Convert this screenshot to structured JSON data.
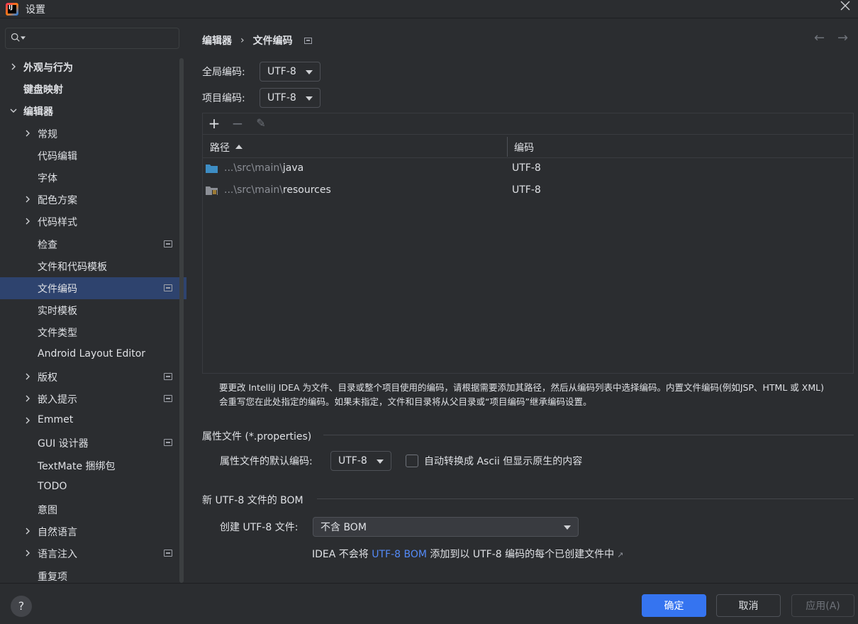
{
  "window": {
    "title": "设置",
    "logo_text": "IJ"
  },
  "search": {
    "placeholder": ""
  },
  "sidebar": {
    "items": [
      {
        "label": "外观与行为",
        "level": 0,
        "chevron": "right",
        "bold": true,
        "project_icon": false,
        "selected": false
      },
      {
        "label": "键盘映射",
        "level": 0,
        "chevron": "",
        "bold": true,
        "project_icon": false,
        "selected": false
      },
      {
        "label": "编辑器",
        "level": 0,
        "chevron": "down",
        "bold": true,
        "project_icon": false,
        "selected": false
      },
      {
        "label": "常规",
        "level": 1,
        "chevron": "right",
        "bold": false,
        "project_icon": false,
        "selected": false
      },
      {
        "label": "代码编辑",
        "level": 1,
        "chevron": "",
        "bold": false,
        "project_icon": false,
        "selected": false
      },
      {
        "label": "字体",
        "level": 1,
        "chevron": "",
        "bold": false,
        "project_icon": false,
        "selected": false
      },
      {
        "label": "配色方案",
        "level": 1,
        "chevron": "right",
        "bold": false,
        "project_icon": false,
        "selected": false
      },
      {
        "label": "代码样式",
        "level": 1,
        "chevron": "right",
        "bold": false,
        "project_icon": false,
        "selected": false
      },
      {
        "label": "检查",
        "level": 1,
        "chevron": "",
        "bold": false,
        "project_icon": true,
        "selected": false
      },
      {
        "label": "文件和代码模板",
        "level": 1,
        "chevron": "",
        "bold": false,
        "project_icon": false,
        "selected": false
      },
      {
        "label": "文件编码",
        "level": 1,
        "chevron": "",
        "bold": false,
        "project_icon": true,
        "selected": true
      },
      {
        "label": "实时模板",
        "level": 1,
        "chevron": "",
        "bold": false,
        "project_icon": false,
        "selected": false
      },
      {
        "label": "文件类型",
        "level": 1,
        "chevron": "",
        "bold": false,
        "project_icon": false,
        "selected": false
      },
      {
        "label": "Android Layout Editor",
        "level": 1,
        "chevron": "",
        "bold": false,
        "project_icon": false,
        "selected": false
      },
      {
        "label": "版权",
        "level": 1,
        "chevron": "right",
        "bold": false,
        "project_icon": true,
        "selected": false
      },
      {
        "label": "嵌入提示",
        "level": 1,
        "chevron": "right",
        "bold": false,
        "project_icon": true,
        "selected": false
      },
      {
        "label": "Emmet",
        "level": 1,
        "chevron": "right",
        "bold": false,
        "project_icon": false,
        "selected": false
      },
      {
        "label": "GUI 设计器",
        "level": 1,
        "chevron": "",
        "bold": false,
        "project_icon": true,
        "selected": false
      },
      {
        "label": "TextMate 捆绑包",
        "level": 1,
        "chevron": "",
        "bold": false,
        "project_icon": false,
        "selected": false
      },
      {
        "label": "TODO",
        "level": 1,
        "chevron": "",
        "bold": false,
        "project_icon": false,
        "selected": false
      },
      {
        "label": "意图",
        "level": 1,
        "chevron": "",
        "bold": false,
        "project_icon": false,
        "selected": false
      },
      {
        "label": "自然语言",
        "level": 1,
        "chevron": "right",
        "bold": false,
        "project_icon": false,
        "selected": false
      },
      {
        "label": "语言注入",
        "level": 1,
        "chevron": "right",
        "bold": false,
        "project_icon": true,
        "selected": false
      },
      {
        "label": "重复项",
        "level": 1,
        "chevron": "",
        "bold": false,
        "project_icon": false,
        "selected": false
      }
    ]
  },
  "breadcrumb": {
    "parent": "编辑器",
    "separator": "›",
    "current": "文件编码"
  },
  "nav": {
    "back": "←",
    "forward": "→"
  },
  "global_encoding": {
    "label": "全局编码:",
    "value": "UTF-8"
  },
  "project_encoding": {
    "label": "项目编码:",
    "value": "UTF-8"
  },
  "table": {
    "toolbar": {
      "add": "+",
      "remove": "−",
      "edit": "✎"
    },
    "columns": [
      "路径",
      "编码"
    ],
    "rows": [
      {
        "prefix": "...\\src\\main\\",
        "name": "java",
        "encoding": "UTF-8",
        "icon": "source-folder-icon"
      },
      {
        "prefix": "...\\src\\main\\",
        "name": "resources",
        "encoding": "UTF-8",
        "icon": "resources-folder-icon"
      }
    ]
  },
  "hint": {
    "line1": "要更改 IntelliJ IDEA 为文件、目录或整个项目使用的编码，请根据需要添加其路径，然后从编码列表中选择编码。内置文件编码(例如JSP、HTML 或 XML)",
    "line2": "会重写您在此处指定的编码。如果未指定，文件和目录将从父目录或“项目编码”继承编码设置。"
  },
  "properties": {
    "section_title": "属性文件 (*.properties)",
    "default_label": "属性文件的默认编码:",
    "default_value": "UTF-8",
    "checkbox_label": "自动转换成 Ascii 但显示原生的内容",
    "checkbox_checked": false
  },
  "bom": {
    "section_title": "新 UTF-8 文件的 BOM",
    "create_label": "创建 UTF-8 文件:",
    "create_value": "不含 BOM",
    "note_before": "IDEA 不会将 ",
    "note_link": "UTF-8 BOM",
    "note_after": " 添加到以 UTF-8 编码的每个已创建文件中",
    "note_arrow": "↗"
  },
  "buttons": {
    "help": "?",
    "ok": "确定",
    "cancel": "取消",
    "apply": "应用(A)"
  },
  "colors": {
    "accent": "#3574f0",
    "selection": "#2e436e",
    "link": "#548af7",
    "background": "#2b2d30"
  }
}
